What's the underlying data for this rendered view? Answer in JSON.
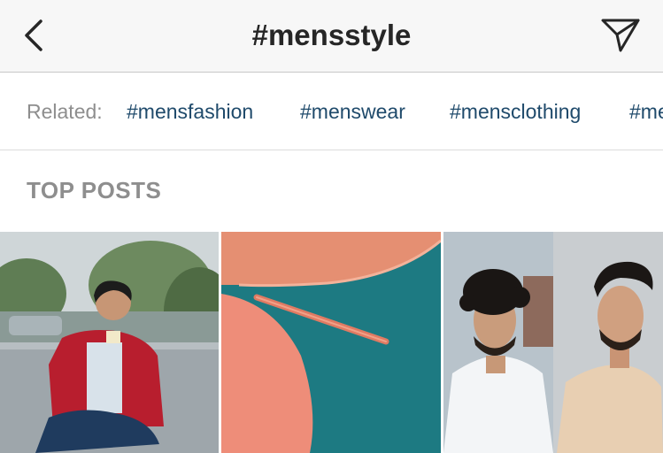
{
  "header": {
    "title": "#mensstyle",
    "back_icon": "chevron-left-icon",
    "share_icon": "paper-plane-icon"
  },
  "related": {
    "label": "Related:",
    "tags": [
      "#mensfashion",
      "#menswear",
      "#mensclothing",
      "#me"
    ]
  },
  "top_posts": {
    "title": "TOP POSTS",
    "posts": [
      {
        "subject": "man in red leather jacket eating on street"
      },
      {
        "subject": "teal fabric with coral lining and welt pocket"
      },
      {
        "subject": "two men with styled hair, side by side"
      }
    ]
  },
  "colors": {
    "tag_link": "#1f4a6b",
    "muted_text": "#8e8e8e",
    "title_text": "#262626",
    "nav_background": "#f7f7f7"
  }
}
